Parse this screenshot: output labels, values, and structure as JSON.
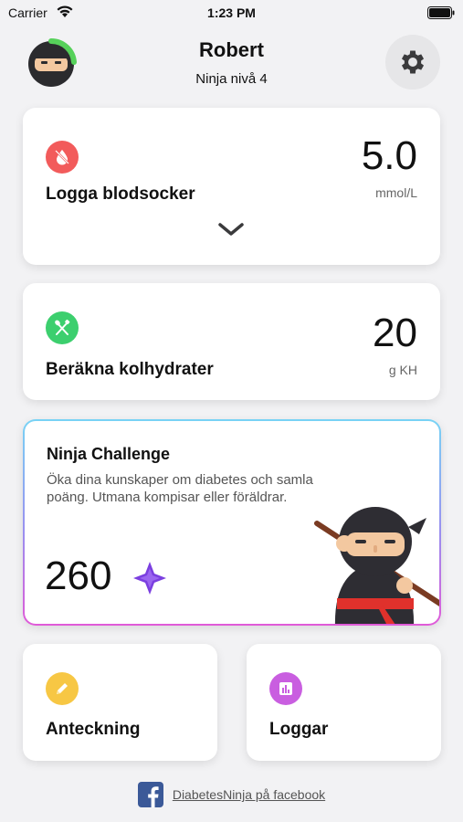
{
  "status_bar": {
    "carrier": "Carrier",
    "time": "1:23 PM"
  },
  "header": {
    "name": "Robert",
    "level": "Ninja nivå 4"
  },
  "blood_sugar_card": {
    "title": "Logga blodsocker",
    "value": "5.0",
    "unit": "mmol/L",
    "icon": "blood-drop-icon",
    "icon_color": "#f25b5b"
  },
  "carbs_card": {
    "title": "Beräkna kolhydrater",
    "value": "20",
    "unit": "g KH",
    "icon": "fork-spoon-icon",
    "icon_color": "#3ccf6e"
  },
  "ninja_card": {
    "title": "Ninja Challenge",
    "description": "Öka dina kunskaper om diabetes och samla poäng. Utmana kompisar eller föräldrar.",
    "points": "260",
    "star_color": "#7b3fe0"
  },
  "notes_card": {
    "title": "Anteckning",
    "icon": "pencil-icon",
    "icon_color": "#f7c744"
  },
  "logs_card": {
    "title": "Loggar",
    "icon": "chart-icon",
    "icon_color": "#c95ee0"
  },
  "footer": {
    "link": "DiabetesNinja på facebook"
  }
}
